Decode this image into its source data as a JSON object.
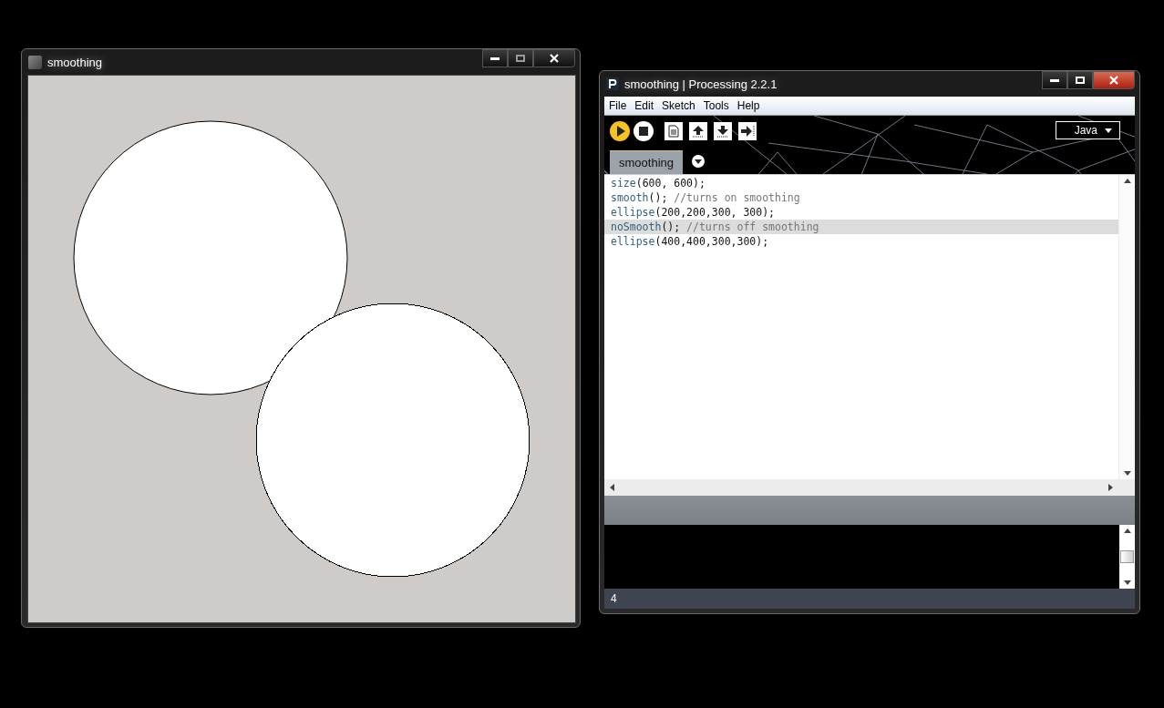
{
  "sketch_window": {
    "title": "smoothing"
  },
  "ide_window": {
    "title": "smoothing | Processing 2.2.1",
    "menu": [
      "File",
      "Edit",
      "Sketch",
      "Tools",
      "Help"
    ],
    "toolbar": [
      {
        "kind": "run"
      },
      {
        "kind": "stop"
      },
      {
        "kind": "new"
      },
      {
        "kind": "open"
      },
      {
        "kind": "save"
      },
      {
        "kind": "export"
      }
    ],
    "mode": "Java",
    "tabs": [
      {
        "label": "smoothing",
        "selected": true
      }
    ],
    "code_lines": [
      {
        "selected": false,
        "tokens": [
          {
            "kind": "function",
            "text": "size"
          },
          {
            "kind": "plain",
            "text": "(600, 600);"
          }
        ]
      },
      {
        "selected": false,
        "tokens": [
          {
            "kind": "function",
            "text": "smooth"
          },
          {
            "kind": "plain",
            "text": "(); "
          },
          {
            "kind": "comment",
            "text": "//turns on smoothing"
          }
        ]
      },
      {
        "selected": false,
        "tokens": [
          {
            "kind": "function",
            "text": "ellipse"
          },
          {
            "kind": "plain",
            "text": "(200,200,300, 300);"
          }
        ]
      },
      {
        "selected": true,
        "tokens": [
          {
            "kind": "function",
            "text": "noSmooth"
          },
          {
            "kind": "plain",
            "text": "(); "
          },
          {
            "kind": "comment",
            "text": "//turns off smoothing"
          }
        ]
      },
      {
        "selected": false,
        "tokens": [
          {
            "kind": "function",
            "text": "ellipse"
          },
          {
            "kind": "plain",
            "text": "(400,400,300,300);"
          }
        ]
      }
    ],
    "status_line": "4"
  }
}
